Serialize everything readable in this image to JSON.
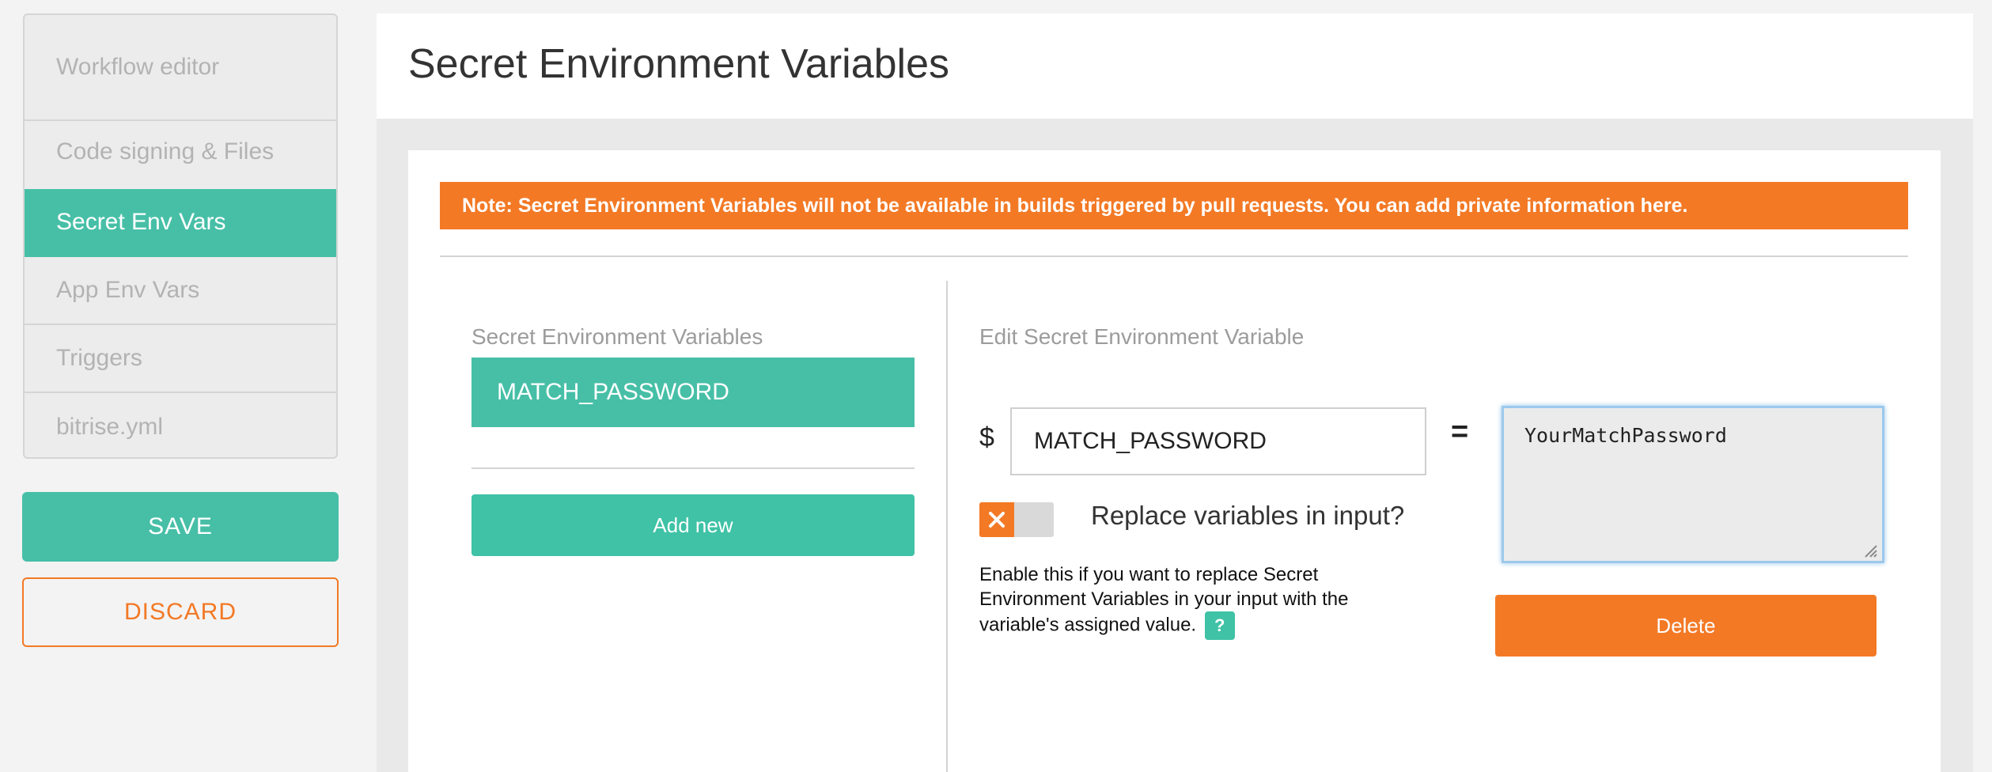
{
  "sidebar": {
    "items": [
      {
        "label": "Workflow editor"
      },
      {
        "label": "Code signing & Files"
      },
      {
        "label": "Secret Env Vars"
      },
      {
        "label": "App Env Vars"
      },
      {
        "label": "Triggers"
      },
      {
        "label": "bitrise.yml"
      }
    ],
    "active_index": 2,
    "save_label": "SAVE",
    "discard_label": "DISCARD"
  },
  "header": {
    "title": "Secret Environment Variables"
  },
  "note": {
    "text": "Note: Secret Environment Variables will not be available in builds triggered by pull requests. You can add private information here."
  },
  "list_panel": {
    "heading": "Secret Environment Variables",
    "variables": [
      "MATCH_PASSWORD"
    ],
    "add_label": "Add new"
  },
  "edit_panel": {
    "heading": "Edit Secret Environment Variable",
    "dollar": "$",
    "key_value": "MATCH_PASSWORD",
    "equals": "=",
    "value": "YourMatchPassword",
    "replace_toggle": {
      "label": "Replace variables in input?",
      "enabled": false
    },
    "help_text": "Enable this if you want to replace Secret Environment Variables in your input with the variable's assigned value.",
    "help_badge": "?",
    "delete_label": "Delete"
  },
  "colors": {
    "accent_green": "#47bfa7",
    "accent_orange": "#f37925"
  }
}
